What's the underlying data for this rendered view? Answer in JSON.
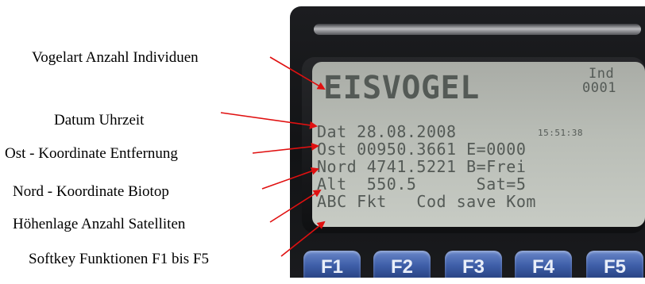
{
  "labels": {
    "bird": "Vogelart   Anzahl Individuen",
    "datetime": "Datum   Uhrzeit",
    "east": "Ost - Koordinate Entfernung",
    "north": "Nord - Koordinate    Biotop",
    "altitude": "Höhenlage   Anzahl Satelliten",
    "softkeys": "Softkey Funktionen  F1 bis F5"
  },
  "screen": {
    "species": "EISVOGEL",
    "ind_label": "Ind",
    "ind_value": "0001",
    "date_line": "Dat 28.08.2008",
    "time": "15:51:38",
    "east_line": "Ost 00950.3661 E=0000",
    "north_line": "Nord 4741.5221 B=Frei",
    "alt_line": "Alt  550.5      Sat=5",
    "softkey_line": "ABC Fkt   Cod save Kom"
  },
  "keys": [
    "F1",
    "F2",
    "F3",
    "F4",
    "F5"
  ],
  "colors": {
    "arrow": "#e01010",
    "lcd_text": "#545a56",
    "key": "#3e5ea8"
  }
}
